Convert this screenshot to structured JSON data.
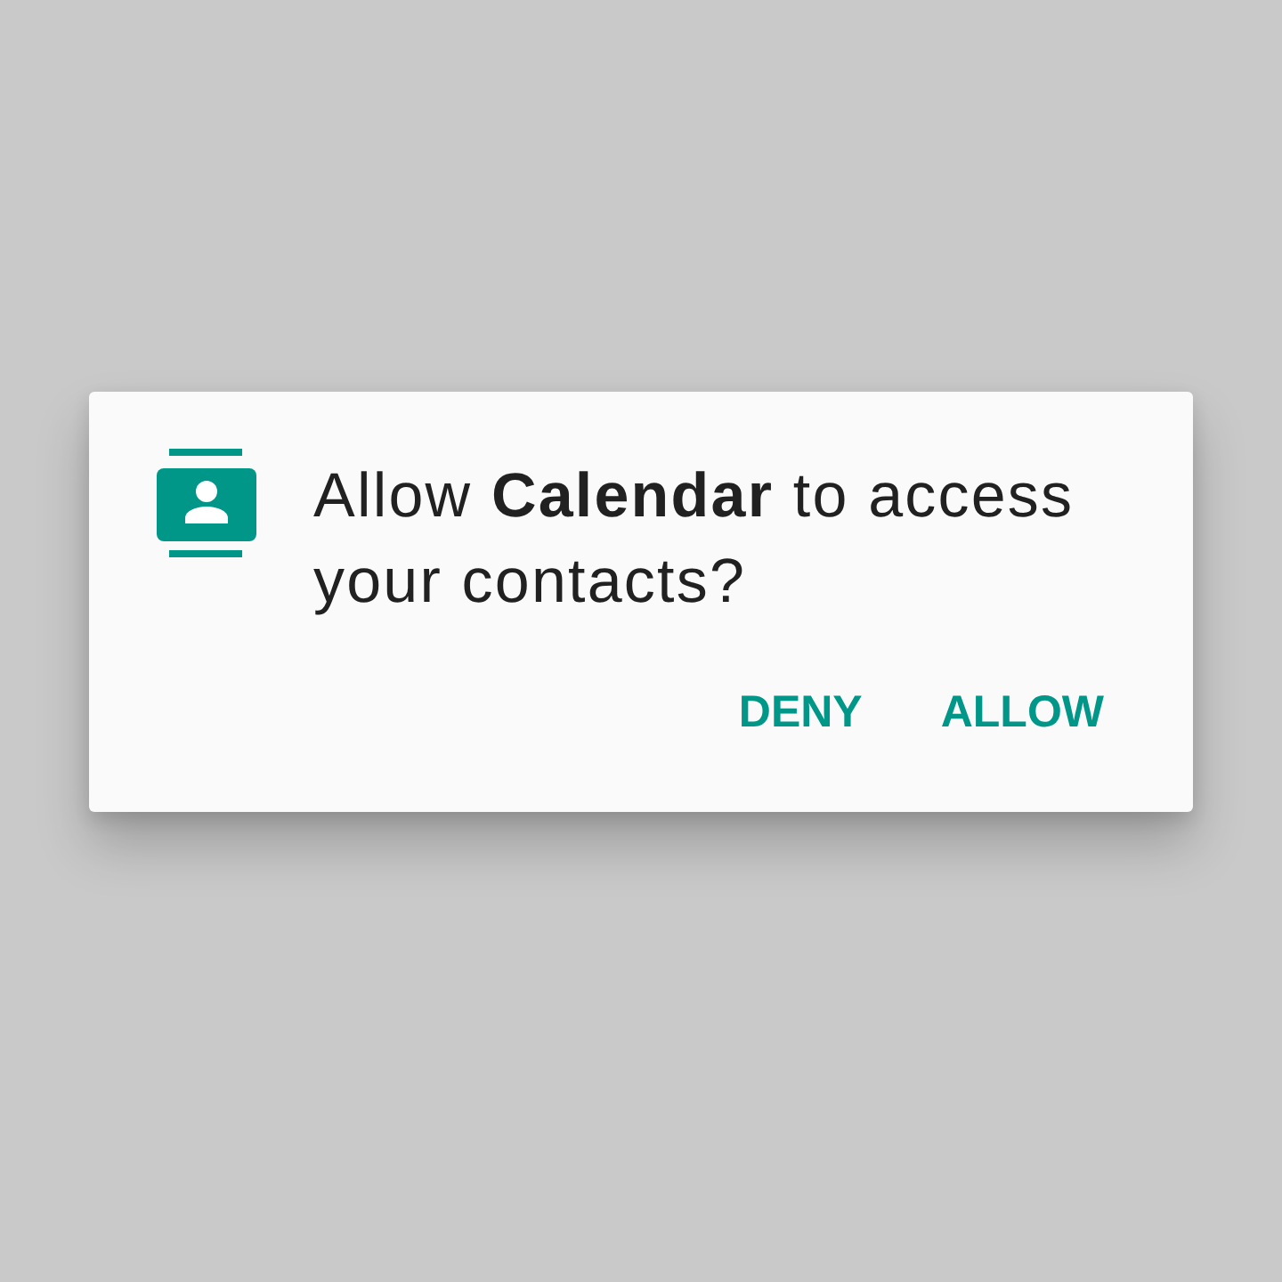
{
  "dialog": {
    "message": "Allow **Calendar** to access your contacts?",
    "buttons": [
      {
        "label": "DENY"
      },
      {
        "label": "ALLOW"
      }
    ]
  }
}
